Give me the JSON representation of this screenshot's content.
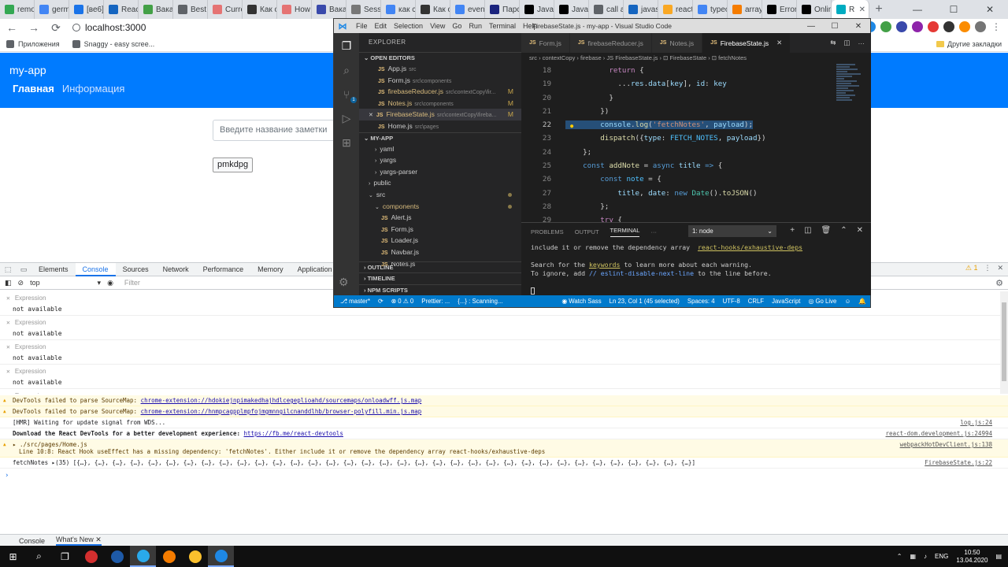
{
  "browser": {
    "tabs": [
      {
        "label": "remo",
        "color": "#34a853"
      },
      {
        "label": "germ",
        "color": "#4285f4"
      },
      {
        "label": "[ве6]",
        "color": "#1a73e8"
      },
      {
        "label": "React",
        "color": "#1565c0"
      },
      {
        "label": "Вака",
        "color": "#43a047"
      },
      {
        "label": "Best",
        "color": "#5f6368"
      },
      {
        "label": "Curre",
        "color": "#e57373"
      },
      {
        "label": "Как с",
        "color": "#333333"
      },
      {
        "label": "How",
        "color": "#e57373"
      },
      {
        "label": "Вака",
        "color": "#3949ab"
      },
      {
        "label": "Sessi",
        "color": "#777777"
      },
      {
        "label": "как с",
        "color": "#4285f4"
      },
      {
        "label": "Как с",
        "color": "#333333"
      },
      {
        "label": "event",
        "color": "#4285f4"
      },
      {
        "label": "Парс",
        "color": "#1a237e"
      },
      {
        "label": "JavaS",
        "color": "#000000"
      },
      {
        "label": "JavaS",
        "color": "#000000"
      },
      {
        "label": "call a",
        "color": "#5f6368"
      },
      {
        "label": "javas",
        "color": "#1565c0"
      },
      {
        "label": "react",
        "color": "#f9a825"
      },
      {
        "label": "typeo",
        "color": "#4285f4"
      },
      {
        "label": "array",
        "color": "#f57c00"
      },
      {
        "label": "Error",
        "color": "#000000"
      },
      {
        "label": "Onlin",
        "color": "#000000"
      },
      {
        "label": "R",
        "color": "#00acc1",
        "active": true
      }
    ],
    "new_tab": "+",
    "url": "localhost:3000",
    "bookmarks": [
      {
        "label": "Приложения"
      },
      {
        "label": "Snaggy - easy scree..."
      }
    ],
    "bookmarks_right": "Другие закладки",
    "win_controls": {
      "minimize": "—",
      "maximize": "☐",
      "close": "✕"
    }
  },
  "app": {
    "brand": "my-app",
    "nav": [
      {
        "label": "Главная",
        "active": true
      },
      {
        "label": "Информация",
        "active": false
      }
    ],
    "input_placeholder": "Введите название заметки",
    "note": "pmkdpg"
  },
  "devtools": {
    "tabs": [
      "Elements",
      "Console",
      "Sources",
      "Network",
      "Performance",
      "Memory",
      "Application",
      "Security"
    ],
    "active_tab": "Console",
    "warnings_count": "1",
    "context": "top",
    "filter_placeholder": "Filter",
    "expressions": [
      {
        "label": "Expression",
        "value": "not available"
      },
      {
        "label": "Expression",
        "value": "not available"
      },
      {
        "label": "Expression",
        "value": "not available"
      },
      {
        "label": "Expression",
        "value": "not available"
      },
      {
        "label": "Expression",
        "value": ""
      }
    ],
    "logs": [
      {
        "type": "warn",
        "prefix": "DevTools failed to parse SourceMap: ",
        "link": "chrome-extension://hdokiejnpimakedhajhdlcegeplioahd/sourcemaps/onloadwff.js.map",
        "source": ""
      },
      {
        "type": "warn",
        "prefix": "DevTools failed to parse SourceMap: ",
        "link": "chrome-extension://hnmpcagpplmpfojmgmnngilcnanddlhb/browser-polyfill.min.js.map",
        "source": ""
      },
      {
        "type": "info",
        "prefix": "[HMR] Waiting for update signal from WDS...",
        "link": "",
        "source": "log.js:24"
      },
      {
        "type": "bold",
        "prefix": "Download the React DevTools for a better development experience: ",
        "link": "https://fb.me/react-devtools",
        "source": "react-dom.development.js:24994"
      },
      {
        "type": "warn",
        "prefix": "▸ ./src/pages/Home.js",
        "link": "",
        "source": "webpackHotDevClient.js:138",
        "line2": "Line 10:8:  React Hook useEffect has a missing dependency: 'fetchNotes'. Either include it or remove the dependency array  react-hooks/exhaustive-deps"
      },
      {
        "type": "info",
        "prefix": "fetchNotes ▸(35) [{…}, {…}, {…}, {…}, {…}, {…}, {…}, {…}, {…}, {…}, {…}, {…}, {…}, {…}, {…}, {…}, {…}, {…}, {…}, {…}, {…}, {…}, {…}, {…}, {…}, {…}, {…}, {…}, {…}, {…}, {…}, {…}, {…}, {…}, {…}]",
        "link": "",
        "source": "FirebaseState.js:22"
      }
    ],
    "prompt": "›",
    "drawer_tabs": [
      "Console",
      "What's New"
    ]
  },
  "vscode": {
    "title": "FirebaseState.js - my-app - Visual Studio Code",
    "menu": [
      "File",
      "Edit",
      "Selection",
      "View",
      "Go",
      "Run",
      "Terminal",
      "Help"
    ],
    "explorer_title": "EXPLORER",
    "open_editors_label": "OPEN EDITORS",
    "open_editors": [
      {
        "name": "App.js",
        "path": "src",
        "mod": "",
        "selected": false,
        "close": false
      },
      {
        "name": "Form.js",
        "path": "src\\components",
        "mod": "",
        "selected": false,
        "close": false
      },
      {
        "name": "firebaseReducer.js",
        "path": "src\\contextCopy\\fir...",
        "mod": "M",
        "selected": false,
        "close": false
      },
      {
        "name": "Notes.js",
        "path": "src\\components",
        "mod": "M",
        "selected": false,
        "close": false
      },
      {
        "name": "FirebaseState.js",
        "path": "src\\contextCopy\\fireba...",
        "mod": "M",
        "selected": true,
        "close": true
      },
      {
        "name": "Home.js",
        "path": "src\\pages",
        "mod": "",
        "selected": false,
        "close": false
      }
    ],
    "project_label": "MY-APP",
    "tree": [
      {
        "name": "yaml",
        "indent": 2,
        "chev": "›",
        "dot": false
      },
      {
        "name": "yargs",
        "indent": 2,
        "chev": "›",
        "dot": false
      },
      {
        "name": "yargs-parser",
        "indent": 2,
        "chev": "›",
        "dot": false
      },
      {
        "name": "public",
        "indent": 1,
        "chev": "›",
        "dot": false
      },
      {
        "name": "src",
        "indent": 1,
        "chev": "⌄",
        "dot": true
      },
      {
        "name": "components",
        "indent": 2,
        "chev": "⌄",
        "dot": true,
        "modified": true
      },
      {
        "name": "Alert.js",
        "indent": 3,
        "chev": "",
        "dot": false,
        "file": true
      },
      {
        "name": "Form.js",
        "indent": 3,
        "chev": "",
        "dot": false,
        "file": true
      },
      {
        "name": "Loader.js",
        "indent": 3,
        "chev": "",
        "dot": false,
        "file": true
      },
      {
        "name": "Navbar.js",
        "indent": 3,
        "chev": "",
        "dot": false,
        "file": true
      },
      {
        "name": "Notes.js",
        "indent": 3,
        "chev": "",
        "dot": false,
        "file": true
      }
    ],
    "bottom_sections": [
      "OUTLINE",
      "TIMELINE",
      "NPM SCRIPTS"
    ],
    "editor_tabs": [
      {
        "name": "Form.js",
        "active": false
      },
      {
        "name": "firebaseReducer.js",
        "active": false
      },
      {
        "name": "Notes.js",
        "active": false
      },
      {
        "name": "FirebaseState.js",
        "active": true
      }
    ],
    "breadcrumbs": "src › contextCopy › firebase › JS FirebaseState.js › ⊡ FirebaseState › ⊡ fetchNotes",
    "code_lines": [
      {
        "n": "18",
        "html": "          <span class='kw2'>return</span> {"
      },
      {
        "n": "19",
        "html": "            ...<span class='var'>res</span>.<span class='var'>data</span>[<span class='var'>key</span>], <span class='var'>id</span>: <span class='var'>key</span>"
      },
      {
        "n": "20",
        "html": "          }"
      },
      {
        "n": "21",
        "html": "        })"
      },
      {
        "n": "22",
        "html": "        <span class='var'>console</span>.<span class='fn'>log</span>(<span class='str'>'fetchNotes'</span>, <span class='var'>payload</span>);",
        "hl": true,
        "bulb": true
      },
      {
        "n": "23",
        "html": "        <span class='fn'>dispatch</span>({<span class='var'>type</span>: <span class='const'>FETCH_NOTES</span>, <span class='var'>payload</span>})"
      },
      {
        "n": "24",
        "html": "    };"
      },
      {
        "n": "25",
        "html": "    <span class='kw'>const</span> <span class='fn'>addNote</span> = <span class='kw'>async</span> <span class='var'>title</span> <span class='kw'>=></span> {"
      },
      {
        "n": "26",
        "html": "        <span class='kw'>const</span> <span class='const'>note</span> = {"
      },
      {
        "n": "27",
        "html": "            <span class='var'>title</span>, <span class='var'>date</span>: <span class='kw'>new</span> <span class='cls'>Date</span>().<span class='fn'>toJSON</span>()"
      },
      {
        "n": "28",
        "html": "        };"
      },
      {
        "n": "29",
        "html": "        <span class='kw2'>try</span> {"
      }
    ],
    "panel_tabs": [
      "PROBLEMS",
      "OUTPUT",
      "TERMINAL",
      "···"
    ],
    "panel_active": "TERMINAL",
    "terminal_select": "1: node",
    "terminal": {
      "l1_pre": "include it or remove the dependency array  ",
      "l1_rule": "react-hooks/exhaustive-deps",
      "l2_pre": "Search for the ",
      "l2_kw": "keywords",
      "l2_post": " to learn more about each warning.",
      "l3_pre": "To ignore, add ",
      "l3_cmt": "// eslint-disable-next-line",
      "l3_post": " to the line before."
    },
    "status_left": [
      "⎇ master*",
      "⟳",
      "⊗ 0 ⚠ 0",
      "Prettier: ...",
      "{...} : Scanning..."
    ],
    "status_right": [
      "◉ Watch Sass",
      "Ln 23, Col 1 (45 selected)",
      "Spaces: 4",
      "UTF-8",
      "CRLF",
      "JavaScript",
      "◎ Go Live",
      "☺",
      "🔔"
    ]
  },
  "taskbar": {
    "lang": "ENG",
    "time": "10:50",
    "date": "13.04.2020"
  }
}
